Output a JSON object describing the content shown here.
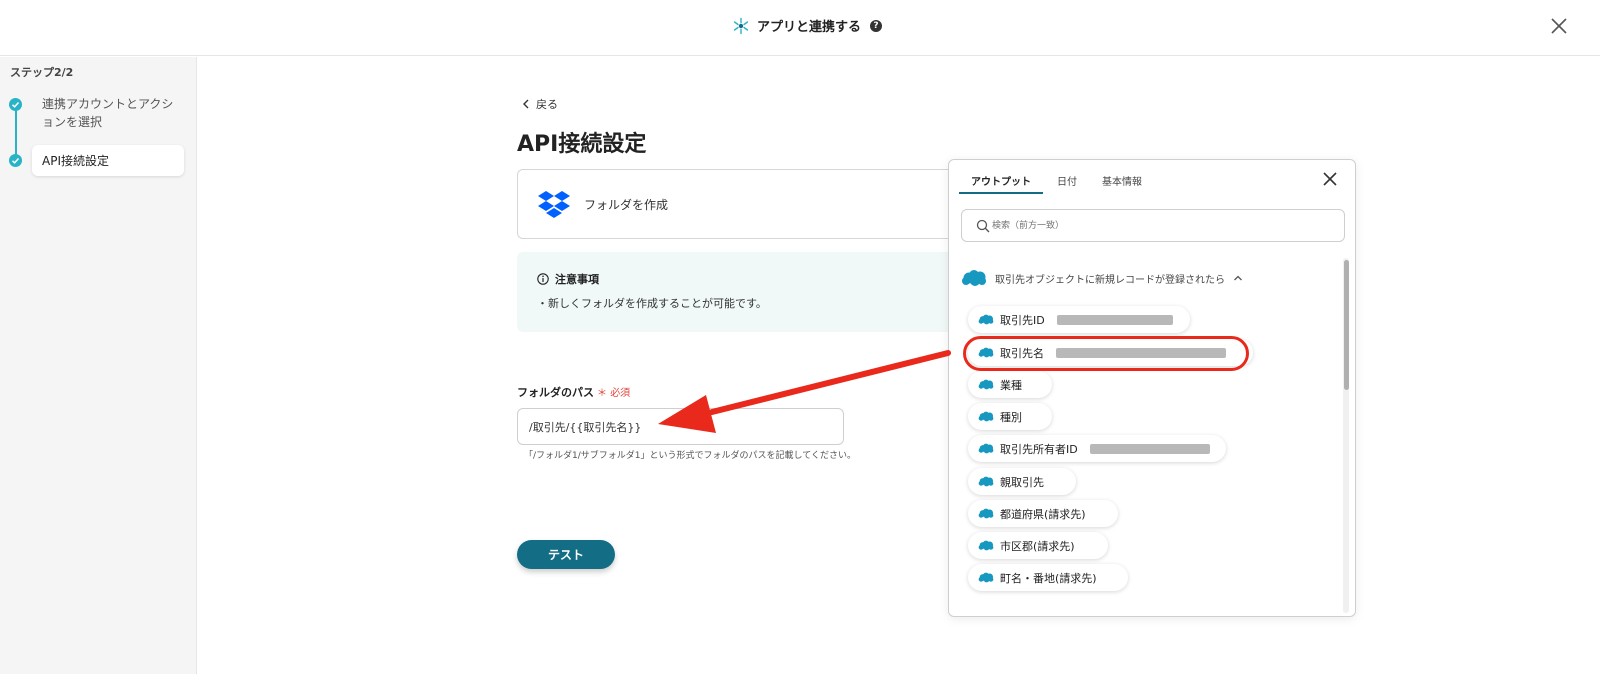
{
  "header": {
    "title": "アプリと連携する",
    "help_icon": "question-icon",
    "close_icon": "close-icon"
  },
  "sidebar": {
    "step_count": "ステップ2/2",
    "steps": [
      {
        "label": "連携アカウントとアクションを選択",
        "status": "done"
      },
      {
        "label": "API接続設定",
        "status": "current"
      }
    ]
  },
  "main": {
    "back_label": "戻る",
    "title": "API接続設定",
    "action": {
      "app_icon": "dropbox-icon",
      "label": "フォルダを作成"
    },
    "notice": {
      "title": "注意事項",
      "body": "・新しくフォルダを作成することが可能です。"
    },
    "folder_path": {
      "label": "フォルダのパス",
      "required_mark": "＊",
      "required_text": "必須",
      "value": "/取引先/{{取引先名}}",
      "hint": "「/フォルダ1/サブフォルダ1」という形式でフォルダのパスを記載してください。"
    },
    "test_button": "テスト"
  },
  "output_panel": {
    "tabs": [
      "アウトプット",
      "日付",
      "基本情報"
    ],
    "active_tab": "アウトプット",
    "search_placeholder": "検索（前方一致）",
    "group_title": "取引先オブジェクトに新規レコードが登録されたら",
    "items": [
      {
        "label": "取引先ID",
        "has_value": true
      },
      {
        "label": "取引先名",
        "has_value": true,
        "highlighted": true
      },
      {
        "label": "業種",
        "has_value": false
      },
      {
        "label": "種別",
        "has_value": false
      },
      {
        "label": "取引先所有者ID",
        "has_value": true
      },
      {
        "label": "親取引先",
        "has_value": false
      },
      {
        "label": "都道府県(請求先)",
        "has_value": false
      },
      {
        "label": "市区郡(請求先)",
        "has_value": false
      },
      {
        "label": "町名・番地(請求先)",
        "has_value": false
      }
    ]
  },
  "colors": {
    "accent": "#136e85",
    "step": "#28b3c7",
    "annotation": "#e8291c",
    "salesforce": "#1798c1",
    "dropbox": "#0061fe"
  }
}
